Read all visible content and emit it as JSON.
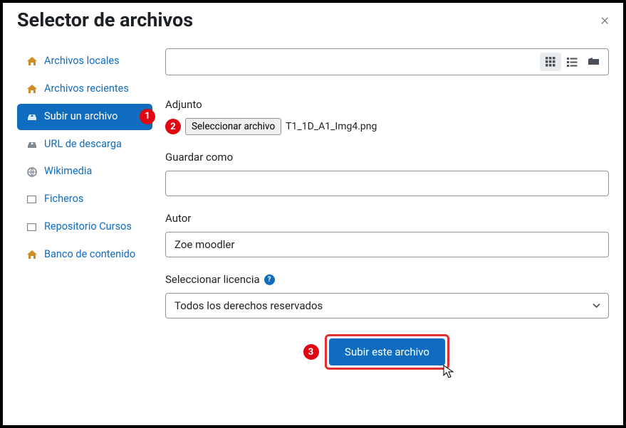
{
  "header": {
    "title": "Selector de archivos"
  },
  "sidebar": {
    "items": [
      {
        "label": "Archivos locales"
      },
      {
        "label": "Archivos recientes"
      },
      {
        "label": "Subir un archivo"
      },
      {
        "label": "URL de descarga"
      },
      {
        "label": "Wikimedia"
      },
      {
        "label": "Ficheros"
      },
      {
        "label": "Repositorio Cursos"
      },
      {
        "label": "Banco de contenido"
      }
    ]
  },
  "form": {
    "attachment_label": "Adjunto",
    "choose_file_button": "Seleccionar archivo",
    "chosen_file_name": "T1_1D_A1_Img4.png",
    "save_as_label": "Guardar como",
    "save_as_value": "",
    "author_label": "Autor",
    "author_value": "Zoe moodler",
    "license_label": "Seleccionar licencia",
    "license_value": "Todos los derechos reservados",
    "submit_label": "Subir este archivo"
  },
  "annotations": {
    "a1": "1",
    "a2": "2",
    "a3": "3"
  }
}
